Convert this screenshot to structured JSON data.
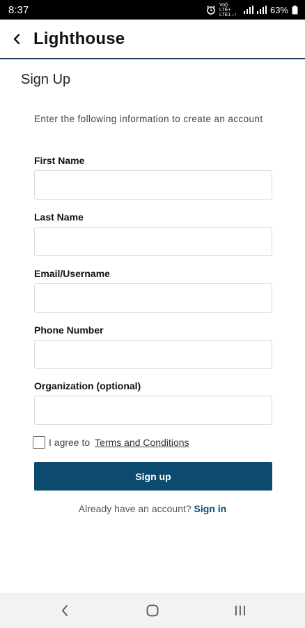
{
  "status_bar": {
    "time": "8:37",
    "network_label": "Vol) LTE+ LTE1 ↓↑",
    "battery_text": "63%",
    "icons": [
      "alarm-icon",
      "signal-icon",
      "signal-icon",
      "battery-icon"
    ]
  },
  "app_bar": {
    "title": "Lighthouse",
    "back_icon": "back-arrow-icon"
  },
  "page": {
    "title": "Sign Up",
    "intro": "Enter the following information to create an account"
  },
  "form": {
    "fields": [
      {
        "label": "First Name",
        "value": ""
      },
      {
        "label": "Last Name",
        "value": ""
      },
      {
        "label": "Email/Username",
        "value": ""
      },
      {
        "label": "Phone Number",
        "value": ""
      },
      {
        "label": "Organization (optional)",
        "value": ""
      }
    ],
    "agree_text": "I agree to",
    "terms_link": "Terms and Conditions",
    "terms_checked": false,
    "submit_label": "Sign up"
  },
  "footer": {
    "prompt": "Already have an account?",
    "signin_link": "Sign in"
  },
  "nav_bar": {
    "icons": [
      "back-icon",
      "home-icon",
      "recents-icon"
    ]
  },
  "colors": {
    "primary": "#0d4a6f",
    "app_bar_border": "#22365e",
    "status_bar_bg": "#000000",
    "nav_bar_bg": "#f2f2f2"
  }
}
